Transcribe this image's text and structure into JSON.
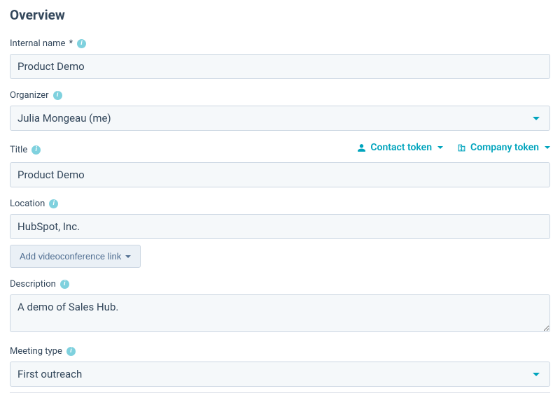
{
  "heading": "Overview",
  "labels": {
    "internal_name": "Internal name",
    "required_mark": "*",
    "organizer": "Organizer",
    "title": "Title",
    "location": "Location",
    "description": "Description",
    "meeting_type": "Meeting type"
  },
  "tokens": {
    "contact": "Contact token",
    "company": "Company token"
  },
  "fields": {
    "internal_name": "Product Demo",
    "organizer": "Julia Mongeau (me)",
    "title": "Product Demo",
    "location": "HubSpot, Inc.",
    "videoconf_button": "Add videoconference link",
    "description": "A demo of Sales Hub.",
    "meeting_type": "First outreach"
  }
}
